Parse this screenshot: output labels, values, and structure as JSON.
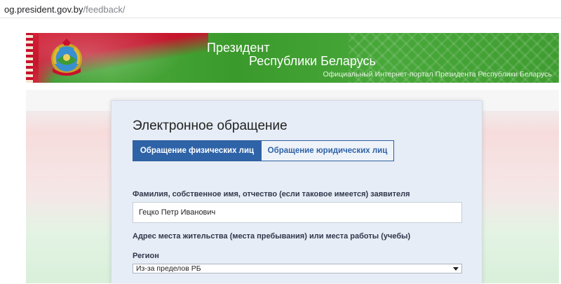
{
  "browser": {
    "url_domain": "og.president.gov.by",
    "url_path": "/feedback/"
  },
  "banner": {
    "title_line1": "Президент",
    "title_line2": "Республики Беларусь",
    "subtitle": "Официальный Интернет-портал Президента Республики Беларусь",
    "emblem_icon": "belarus-coat-of-arms-icon",
    "colors": {
      "red": "#c8102e",
      "green": "#3f9b32"
    }
  },
  "form": {
    "heading": "Электронное обращение",
    "tabs": [
      {
        "label": "Обращение физических лиц",
        "active": true
      },
      {
        "label": "Обращение юридических лиц",
        "active": false
      }
    ],
    "name_label": "Фамилия, собственное имя, отчество (если таковое имеется) заявителя",
    "name_value": "Гецко Петр Иванович",
    "address_label": "Адрес места жительства (места пребывания) или места работы (учебы)",
    "region_label": "Регион",
    "region_value": "Из-за пределов РБ",
    "accent_color": "#2f63a7"
  }
}
